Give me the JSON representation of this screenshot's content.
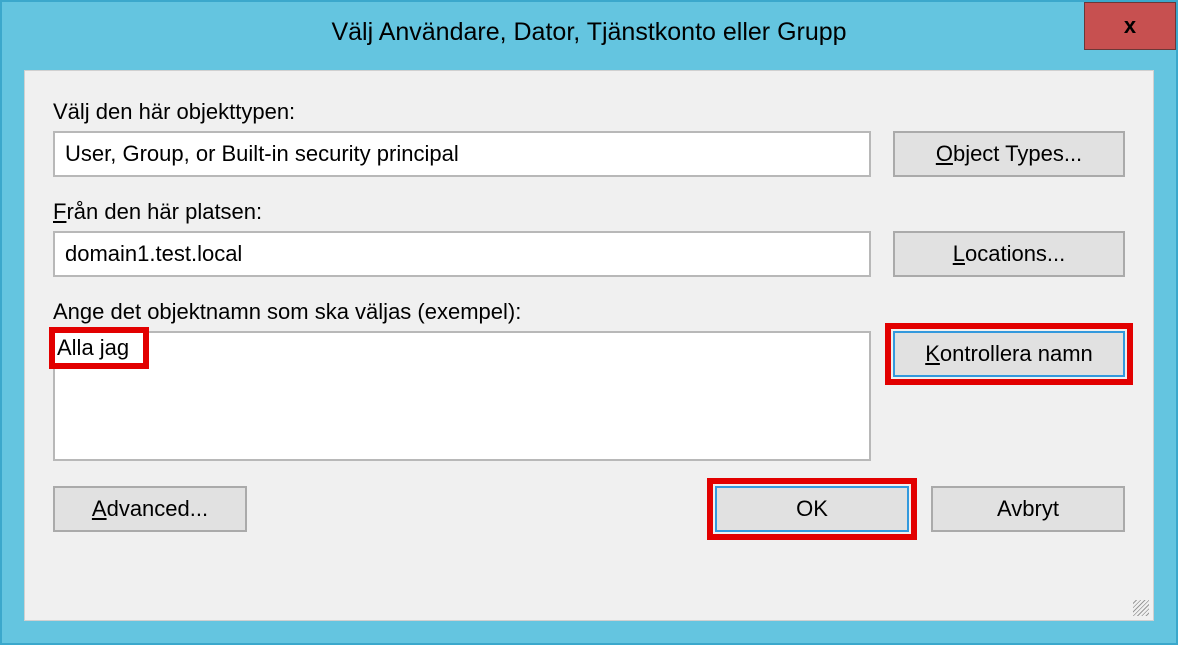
{
  "window": {
    "title": "Välj Användare, Dator, Tjänstkonto eller Grupp",
    "close": "x"
  },
  "labels": {
    "object_type": "Välj den här objekttypen:",
    "location": "Från den här platsen:",
    "object_name": "Ange det objektnamn som ska väljas (exempel):"
  },
  "fields": {
    "object_type_value": "User, Group, or Built-in security principal",
    "location_value": "domain1.test.local",
    "object_name_value": "Alla jag"
  },
  "buttons": {
    "object_types_prefix": "O",
    "object_types_rest": "bject Types...",
    "locations_prefix": "L",
    "locations_rest": "ocations...",
    "check_names_prefix": "K",
    "check_names_rest": "ontrollera namn",
    "advanced_prefix": "A",
    "advanced_rest": "dvanced...",
    "ok": "OK",
    "cancel": "Avbryt"
  }
}
